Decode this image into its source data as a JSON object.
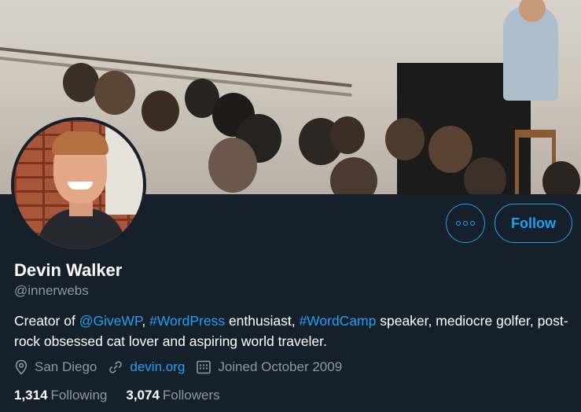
{
  "profile": {
    "name": "Devin Walker",
    "handle": "@innerwebs",
    "bio": {
      "t1": "Creator of ",
      "l1": "@GiveWP",
      "t2": ", ",
      "l2": "#WordPress",
      "t3": " enthusiast, ",
      "l3": "#WordCamp",
      "t4": " speaker, mediocre golfer, post-rock obsessed cat lover and aspiring world traveler."
    },
    "location": "San Diego",
    "website": "devin.org",
    "joined": "Joined October 2009"
  },
  "actions": {
    "follow_label": "Follow",
    "more_icon": "more-dots-icon"
  },
  "stats": {
    "following_count": "1,314",
    "following_label": "Following",
    "followers_count": "3,074",
    "followers_label": "Followers"
  },
  "colors": {
    "background": "#15202b",
    "accent": "#1da1f2",
    "secondary_text": "#8899a6",
    "primary_text": "#ffffff"
  }
}
